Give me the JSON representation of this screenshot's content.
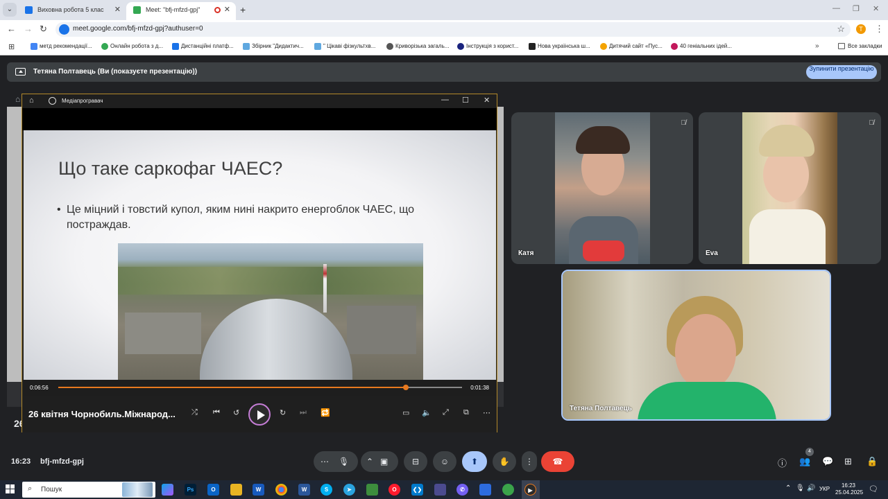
{
  "browser": {
    "tabs": [
      {
        "title": "Виховна робота 5 клас",
        "close": "✕"
      },
      {
        "title": "Meet: \"bfj-mfzd-gpj\"",
        "close": "✕"
      }
    ],
    "new_tab": "+",
    "url": "meet.google.com/bfj-mfzd-gpj?authuser=0",
    "profile_initial": "T",
    "bookmarks": [
      "метд рекомендації...",
      "Онлайн робота з д...",
      "Дистанційні платф...",
      "Збірник \"Дидактич...",
      "\" Цікаві фізкультхв...",
      "Криворізька загаль...",
      "Інструкція з корист...",
      "Нова українська ш...",
      "Дитячий сайт «Пус...",
      "40 геніальних ідей..."
    ],
    "bookmarks_more": "»",
    "all_bookmarks": "Все закладки"
  },
  "meet": {
    "presenting_banner": "Тетяна Полтавець (Ви (показуєте презентацію))",
    "stop_presenting": "Зупинити презентацію",
    "clock": "16:23",
    "meeting_code": "bfj-mfzd-gpj",
    "participants_count": "4",
    "ghost_number": "26"
  },
  "player": {
    "app_name": "Медіапрогравач",
    "slide_title": "Що таке саркофаг ЧАЕС?",
    "slide_bullet": "Це міцний і товстий купол, яким нині накрито енергоблок ЧАЕС, що постраждав.",
    "time_elapsed": "0:06:56",
    "time_remaining": "0:01:38",
    "progress_percent": 86,
    "video_title": "26 квітня Чорнобиль.Міжнарод..."
  },
  "participants": [
    {
      "name": "Катя",
      "muted": true
    },
    {
      "name": "Eva",
      "muted": true
    },
    {
      "name": "Тетяна Полтавець",
      "muted": false
    }
  ],
  "taskbar": {
    "search_label": "Пошук",
    "lang": "УКР",
    "time": "16:23",
    "date": "25.04.2025"
  },
  "colors": {
    "meet_bg": "#202124",
    "accent_blue": "#a8c7fa",
    "leave_red": "#ea4335",
    "seek_orange": "#e8791f",
    "player_border": "#b48a2a"
  }
}
